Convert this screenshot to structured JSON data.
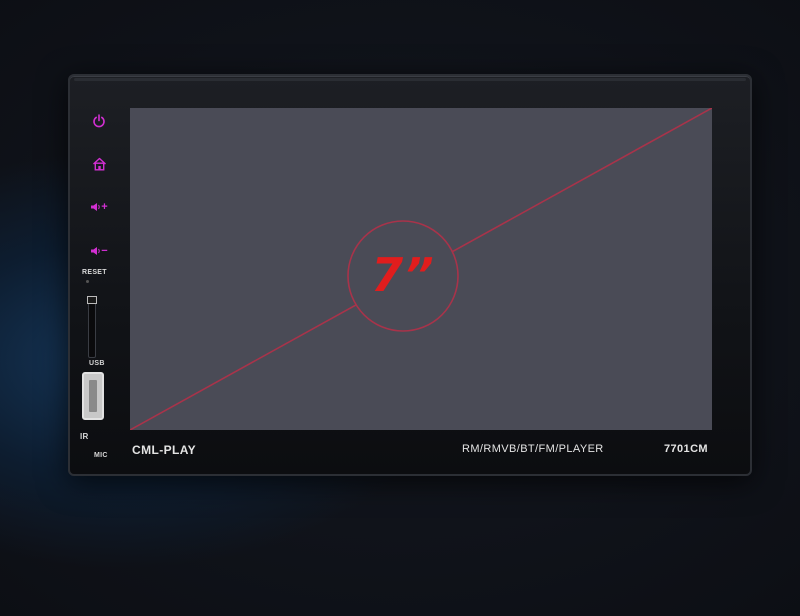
{
  "device": {
    "brand": "CML-PLAY",
    "features": "RM/RMVB/BT/FM/PLAYER",
    "model": "7701CM",
    "screen_size_label": "7”"
  },
  "side_panel": {
    "reset_label": "RESET",
    "usb_label": "USB",
    "ir_label": "IR",
    "mic_label": "MIC",
    "vol_up_symbol": "+",
    "vol_down_symbol": "−"
  },
  "colors": {
    "button_glow": "#d22fd2",
    "screen": "#4a4b56",
    "size_label": "#e11d1d"
  },
  "icons": [
    "power-icon",
    "home-icon",
    "volume-up-icon",
    "volume-down-icon"
  ]
}
